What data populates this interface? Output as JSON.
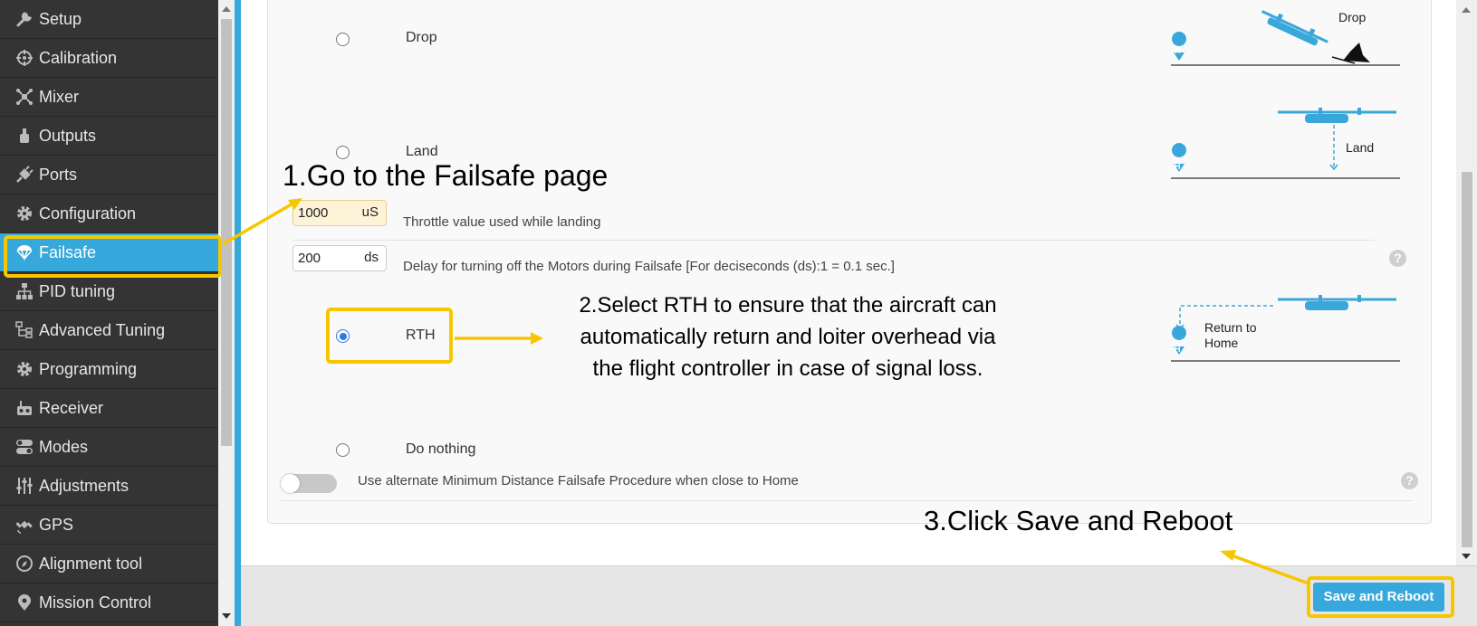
{
  "sidebar": {
    "items": [
      {
        "label": "Setup",
        "icon": "wrench-icon"
      },
      {
        "label": "Calibration",
        "icon": "crosshair-icon"
      },
      {
        "label": "Mixer",
        "icon": "mixer-icon"
      },
      {
        "label": "Outputs",
        "icon": "motor-icon"
      },
      {
        "label": "Ports",
        "icon": "plug-icon"
      },
      {
        "label": "Configuration",
        "icon": "gear-icon"
      },
      {
        "label": "Failsafe",
        "icon": "parachute-icon",
        "active": true
      },
      {
        "label": "PID tuning",
        "icon": "hierarchy-icon"
      },
      {
        "label": "Advanced Tuning",
        "icon": "tree-icon"
      },
      {
        "label": "Programming",
        "icon": "gear-icon"
      },
      {
        "label": "Receiver",
        "icon": "remote-icon"
      },
      {
        "label": "Modes",
        "icon": "toggles-icon"
      },
      {
        "label": "Adjustments",
        "icon": "sliders-icon"
      },
      {
        "label": "GPS",
        "icon": "satellite-icon"
      },
      {
        "label": "Alignment tool",
        "icon": "compass-icon"
      },
      {
        "label": "Mission Control",
        "icon": "map-pin-icon"
      }
    ]
  },
  "failsafe": {
    "options": {
      "drop": {
        "label": "Drop",
        "selected": false
      },
      "land": {
        "label": "Land",
        "selected": false
      },
      "rth": {
        "label": "RTH",
        "selected": true
      },
      "do_nothing": {
        "label": "Do nothing",
        "selected": false
      }
    },
    "throttle": {
      "value": "1000",
      "unit": "uS",
      "label": "Throttle value used while landing"
    },
    "delay": {
      "value": "200",
      "unit": "ds",
      "label": "Delay for turning off the Motors during Failsafe [For deciseconds (ds):1 = 0.1 sec.]"
    },
    "min_distance_toggle": {
      "label": "Use alternate Minimum Distance Failsafe Procedure when close to Home",
      "on": false
    },
    "help_glyph": "?"
  },
  "illustrations": {
    "drop_label": "Drop",
    "land_label": "Land",
    "rth_label_line1": "Return to",
    "rth_label_line2": "Home",
    "home_marker": "H"
  },
  "footer": {
    "save_label": "Save and Reboot"
  },
  "annotations": {
    "step1": "1.Go to the Failsafe page",
    "step2_line1": "2.Select RTH to ensure that the aircraft can",
    "step2_line2": "automatically return and loiter overhead via",
    "step2_line3": "the flight controller in case of signal loss.",
    "step3": "3.Click Save and Reboot"
  },
  "colors": {
    "sidebar_bg": "#343434",
    "accent": "#37a8db",
    "highlight": "#f6c700",
    "drone": "#3aa7db"
  }
}
